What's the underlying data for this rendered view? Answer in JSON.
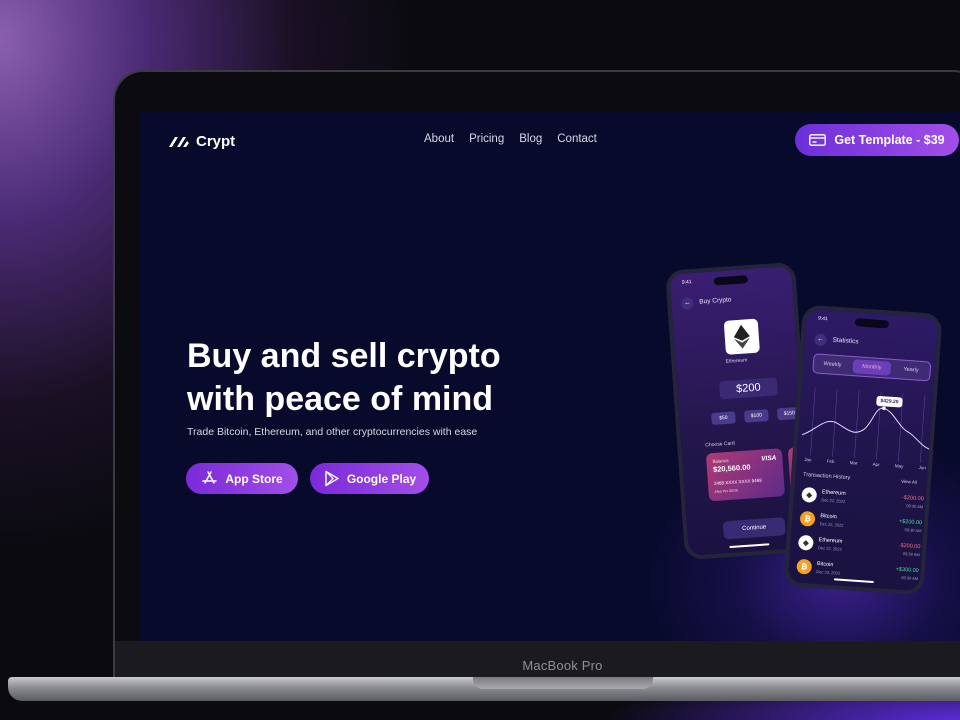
{
  "brand": {
    "name": "Crypt"
  },
  "nav": {
    "items": [
      "About",
      "Pricing",
      "Blog",
      "Contact"
    ]
  },
  "cta": {
    "label": "Get Template - $39"
  },
  "hero": {
    "title_line1": "Buy and sell crypto",
    "title_line2": "with peace of mind",
    "subtitle": "Trade Bitcoin, Ethereum, and other cryptocurrencies with ease",
    "app_store": "App Store",
    "google_play": "Google Play"
  },
  "device": {
    "label": "MacBook Pro"
  },
  "phone_buy": {
    "time": "9:41",
    "title": "Buy Crypto",
    "coin": "Ethereum",
    "amount": "$200",
    "presets": [
      "$50",
      "$100",
      "$150"
    ],
    "choose_card": "Choose Card",
    "card_balance_label": "Balance",
    "card_balance": "$20,560.00",
    "card_brand": "VISA",
    "card_number": "2468 XXXX XXXX 9469",
    "card_meta": "Alba Yes   05/26",
    "continue": "Continue"
  },
  "phone_stats": {
    "time": "9:41",
    "title": "Statistics",
    "segments": [
      "Weekly",
      "Monthly",
      "Yearly"
    ],
    "active_segment": "Monthly",
    "tooltip": "$429.20",
    "chart_months": [
      "Jan",
      "Feb",
      "Mar",
      "Apr",
      "May",
      "Jun"
    ],
    "transactions_title": "Transaction History",
    "view_all": "View All",
    "transactions": [
      {
        "coin": "Ethereum",
        "date": "Dec 22, 2022",
        "amount": "-$200.00",
        "time": "09:30 AM",
        "type": "eth",
        "sign": "neg"
      },
      {
        "coin": "Bitcoin",
        "date": "Dec 22, 2022",
        "amount": "+$200.00",
        "time": "09:30 AM",
        "type": "btc",
        "sign": "pos"
      },
      {
        "coin": "Ethereum",
        "date": "Dec 22, 2022",
        "amount": "-$200.00",
        "time": "09:30 AM",
        "type": "eth",
        "sign": "neg"
      },
      {
        "coin": "Bitcoin",
        "date": "Dec 23, 2022",
        "amount": "+$300.00",
        "time": "09:30 AM",
        "type": "btc",
        "sign": "pos"
      }
    ]
  },
  "colors": {
    "accent_start": "#6c2fd9",
    "accent_end": "#a24ee8",
    "screen_bg": "#080a2c"
  },
  "icons": {
    "logo": "crypt-logo-icon",
    "cta": "credit-card-icon",
    "app_store": "app-store-icon",
    "google_play": "google-play-icon"
  }
}
